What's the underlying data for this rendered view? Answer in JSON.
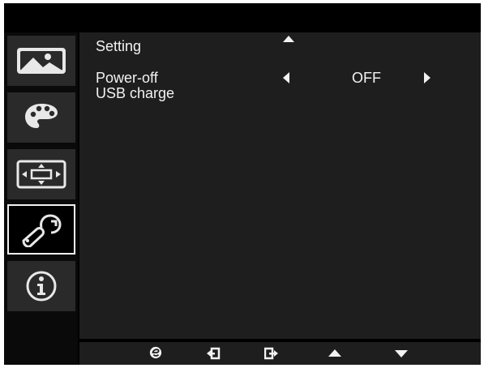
{
  "menu": {
    "title": "Setting",
    "items": [
      {
        "label": "Power-off USB charge",
        "line1": "Power-off",
        "line2": "USB charge",
        "value": "OFF"
      }
    ]
  },
  "sidebar": {
    "items": [
      {
        "icon": "picture-icon",
        "selected": false
      },
      {
        "icon": "palette-icon",
        "selected": false
      },
      {
        "icon": "position-icon",
        "selected": false
      },
      {
        "icon": "wrench-icon",
        "selected": true
      },
      {
        "icon": "info-icon",
        "selected": false
      }
    ]
  },
  "bottom_bar": {
    "icons": [
      "empowering-e-icon",
      "enter-icon",
      "exit-icon",
      "up-arrow-icon",
      "down-arrow-icon"
    ]
  },
  "colors": {
    "background": "#000000",
    "panel": "#1e1e1e",
    "sidebar_button": "#2a2a2a",
    "text": "#f2f2f2"
  }
}
